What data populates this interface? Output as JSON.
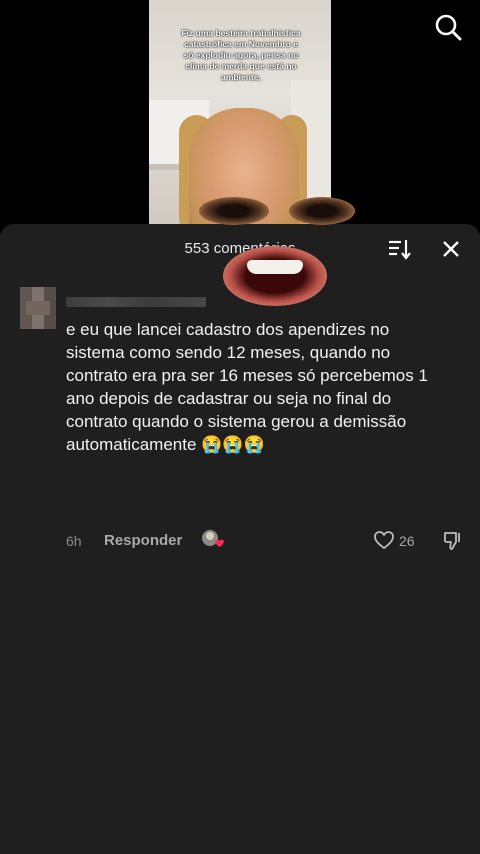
{
  "video": {
    "caption": "Fiz uma besteira trabalhistica catastrófica em Novembro e só explodiu agora, pensa no clima de merda que está no ambiente."
  },
  "icons": {
    "search": "search-icon",
    "sort": "sort-icon",
    "close": "close-icon",
    "like": "heart-icon",
    "dislike": "thumbs-down-icon",
    "creator_like": "creator-liked-icon"
  },
  "comments_panel": {
    "title": "553 comentários",
    "comment": {
      "text": "e eu que lancei cadastro dos apendizes no sistema como sendo 12 meses, quando no contrato era pra ser 16 meses só percebemos 1 ano depois de cadastrar ou seja no final do contrato quando o sistema gerou a demissão automaticamente 😭😭😭",
      "time": "6h",
      "reply_label": "Responder",
      "like_count": "26"
    }
  },
  "colors": {
    "sheet_bg": "#1f1f1f",
    "heart_badge": "#fe2c55"
  }
}
